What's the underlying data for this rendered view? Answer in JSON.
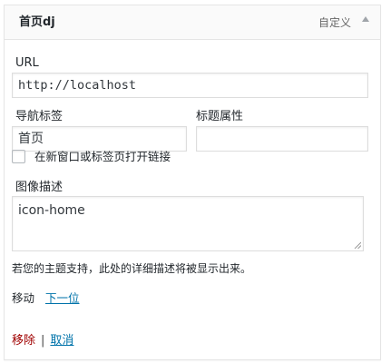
{
  "header": {
    "title": "首页dj",
    "item_type": "自定义"
  },
  "fields": {
    "url": {
      "label": "URL",
      "value": "http://localhost"
    },
    "nav_label": {
      "label": "导航标签",
      "value": "首页"
    },
    "title_attr": {
      "label": "标题属性",
      "value": ""
    },
    "open_new_tab": {
      "label": "在新窗口或标签页打开链接",
      "checked": false
    },
    "image_desc": {
      "label": "图像描述",
      "value": "icon-home"
    }
  },
  "description_text": "若您的主题支持，此处的详细描述将被显示出来。",
  "move": {
    "label": "移动",
    "next_link": "下一位"
  },
  "actions": {
    "remove": "移除",
    "separator": "|",
    "cancel": "取消"
  },
  "colors": {
    "link": "#0073aa",
    "remove": "#a00000",
    "border": "#dddddd"
  }
}
